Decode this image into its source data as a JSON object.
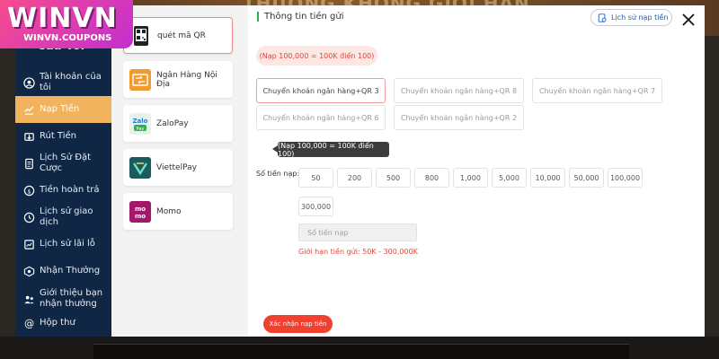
{
  "background": {
    "banner_text": "THƯỞNG KHÔNG GIỚI HẠN"
  },
  "logo": {
    "main": "WINVN",
    "sub": "WINVN.COUPONS"
  },
  "sidebar": {
    "heading": "Của Tôi",
    "items": [
      {
        "label": "Tài khoản của tôi",
        "icon": "user-circle-icon"
      },
      {
        "label": "Nạp Tiền",
        "icon": "deposit-icon"
      },
      {
        "label": "Rút Tiền",
        "icon": "withdraw-icon"
      },
      {
        "label": "Lịch Sử Đặt Cược",
        "icon": "document-icon"
      },
      {
        "label": "Tiền hoàn trả",
        "icon": "refund-icon"
      },
      {
        "label": "Lịch sử giao dịch",
        "icon": "history-icon"
      },
      {
        "label": "Lịch sử lãi lỗ",
        "icon": "profit-loss-icon"
      },
      {
        "label": "Nhận Thưởng",
        "icon": "gift-icon"
      },
      {
        "label": "Giới thiệu bạn nhận thưởng",
        "icon": "referral-icon"
      },
      {
        "label": "Hộp thư",
        "icon": "mail-icon"
      }
    ],
    "active_index": 1
  },
  "methods": [
    {
      "label": "quét mã QR",
      "icon": "qr-code-icon"
    },
    {
      "label": "Ngân Hàng Nội Địa",
      "icon": "bank-transfer-icon"
    },
    {
      "label": "ZaloPay",
      "icon": "zalopay-icon"
    },
    {
      "label": "ViettelPay",
      "icon": "viettelpay-icon"
    },
    {
      "label": "Momo",
      "icon": "momo-icon"
    }
  ],
  "main": {
    "tab_title": "Thông tin tiền gửi",
    "history_button": "Lịch sử nạp tiền",
    "note": "(Nạp 100,000 = 100K điển 100)",
    "qr_options": [
      "Chuyển khoản ngân hàng+QR 3",
      "Chuyển khoản ngân hàng+QR 8",
      "Chuyển khoản ngân hàng+QR 7",
      "Chuyển khoản ngân hàng+QR 6",
      "Chuyển khoản ngân hàng+QR 2"
    ],
    "tooltip": "(Nạp 100,000 = 100K điển 100)",
    "amount_label": "Số tiền nạp:",
    "amounts": [
      "50",
      "200",
      "500",
      "800",
      "1,000",
      "5,000",
      "10,000",
      "50,000",
      "100,000",
      "300,000"
    ],
    "amount_placeholder": "Số tiền nạp",
    "limit_text": "Giới hạn tiền gửi:  50K  - 300,000K",
    "confirm_button": "Xác nhận nạp tiền"
  },
  "colors": {
    "sidebar_bg": "#0f2744",
    "active_item": "#f2b35f",
    "accent_red": "#f0402f",
    "logo_pink": "#f64b8e"
  }
}
